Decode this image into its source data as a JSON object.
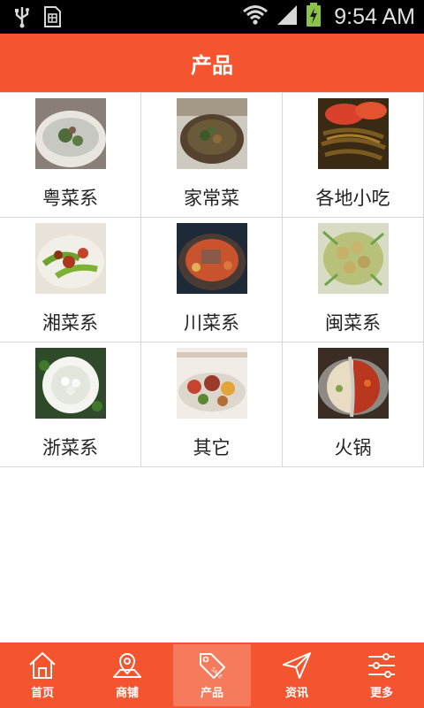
{
  "status_bar": {
    "time": "9:54 AM",
    "icons": [
      "usb-icon",
      "sim-icon",
      "wifi-icon",
      "signal-icon",
      "battery-charging-icon"
    ]
  },
  "header": {
    "title": "产品"
  },
  "colors": {
    "accent": "#f4552f",
    "active_tab": "#f67b5d"
  },
  "categories": [
    {
      "label": "粤菜系",
      "image": "soup-dish"
    },
    {
      "label": "家常菜",
      "image": "home-dish"
    },
    {
      "label": "各地小吃",
      "image": "noodle-snack"
    },
    {
      "label": "湘菜系",
      "image": "pepper-dish"
    },
    {
      "label": "川菜系",
      "image": "sichuan-pot"
    },
    {
      "label": "闽菜系",
      "image": "abalone-dish"
    },
    {
      "label": "浙菜系",
      "image": "white-bowl"
    },
    {
      "label": "其它",
      "image": "platter"
    },
    {
      "label": "火锅",
      "image": "hotpot"
    }
  ],
  "bottom_nav": {
    "items": [
      {
        "label": "首页",
        "icon": "home-icon"
      },
      {
        "label": "商铺",
        "icon": "map-pin-icon"
      },
      {
        "label": "产品",
        "icon": "sale-tag-icon",
        "active": true
      },
      {
        "label": "资讯",
        "icon": "paper-plane-icon"
      },
      {
        "label": "更多",
        "icon": "sliders-icon"
      }
    ]
  }
}
